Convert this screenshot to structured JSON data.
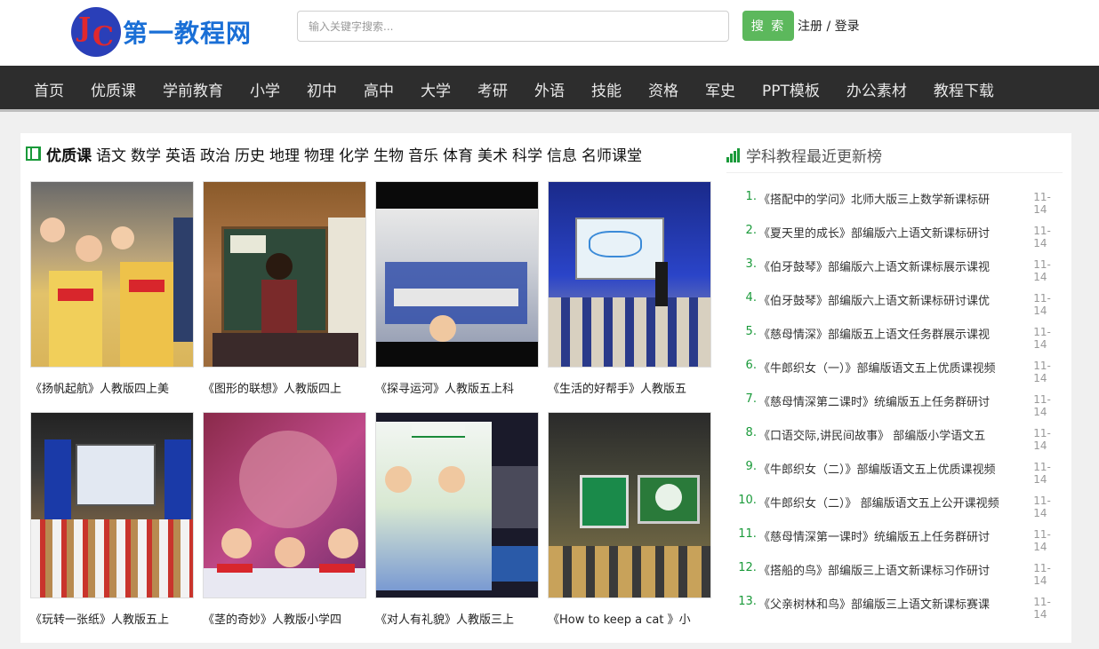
{
  "header": {
    "logo_text": "第一教程网",
    "logo_letters": [
      "J",
      "C"
    ],
    "search_placeholder": "输入关键字搜索...",
    "search_button": "搜 索",
    "register": "注册",
    "separator": " / ",
    "login": "登录"
  },
  "nav": [
    "首页",
    "优质课",
    "学前教育",
    "小学",
    "初中",
    "高中",
    "大学",
    "考研",
    "外语",
    "技能",
    "资格",
    "军史",
    "PPT模板",
    "办公素材",
    "教程下载"
  ],
  "featured": {
    "title": "优质课",
    "categories": [
      "语文",
      "数学",
      "英语",
      "政治",
      "历史",
      "地理",
      "物理",
      "化学",
      "生物",
      "音乐",
      "体育",
      "美术",
      "科学",
      "信息",
      "名师课堂"
    ],
    "cards": [
      {
        "caption": "《扬帆起航》人教版四上美"
      },
      {
        "caption": "《图形的联想》人教版四上"
      },
      {
        "caption": "《探寻运河》人教版五上科"
      },
      {
        "caption": "《生活的好帮手》人教版五"
      },
      {
        "caption": "《玩转一张纸》人教版五上"
      },
      {
        "caption": "《茎的奇妙》人教版小学四"
      },
      {
        "caption": "《对人有礼貌》人教版三上"
      },
      {
        "caption": "《How to keep a cat 》小"
      }
    ]
  },
  "ranking": {
    "title": "学科教程最近更新榜",
    "items": [
      {
        "num": "1.",
        "title": "《搭配中的学问》北师大版三上数学新课标研",
        "date": "11-14"
      },
      {
        "num": "2.",
        "title": "《夏天里的成长》部编版六上语文新课标研讨",
        "date": "11-14"
      },
      {
        "num": "3.",
        "title": "《伯牙鼓琴》部编版六上语文新课标展示课视",
        "date": "11-14"
      },
      {
        "num": "4.",
        "title": "《伯牙鼓琴》部编版六上语文新课标研讨课优",
        "date": "11-14"
      },
      {
        "num": "5.",
        "title": "《慈母情深》部编版五上语文任务群展示课视",
        "date": "11-14"
      },
      {
        "num": "6.",
        "title": "《牛郎织女（一）》部编版语文五上优质课视频",
        "date": "11-14"
      },
      {
        "num": "7.",
        "title": "《慈母情深第二课时》统编版五上任务群研讨",
        "date": "11-14"
      },
      {
        "num": "8.",
        "title": "《口语交际,讲民间故事》 部编版小学语文五",
        "date": "11-14"
      },
      {
        "num": "9.",
        "title": "《牛郎织女（二）》部编版语文五上优质课视频",
        "date": "11-14"
      },
      {
        "num": "10.",
        "title": "《牛郎织女（二）》 部编版语文五上公开课视频",
        "date": "11-14"
      },
      {
        "num": "11.",
        "title": "《慈母情深第一课时》统编版五上任务群研讨",
        "date": "11-14"
      },
      {
        "num": "12.",
        "title": "《搭船的鸟》部编版三上语文新课标习作研讨",
        "date": "11-14"
      },
      {
        "num": "13.",
        "title": "《父亲树林和鸟》部编版三上语文新课标赛课",
        "date": "11-14"
      }
    ]
  },
  "colors": {
    "brand_blue": "#1a6fd6",
    "accent_green": "#1a9a3a",
    "search_green": "#5cb85c",
    "nav_bg": "#2d2d2d"
  },
  "icons": {
    "featured": "film-icon",
    "ranking": "bar-chart-icon"
  }
}
